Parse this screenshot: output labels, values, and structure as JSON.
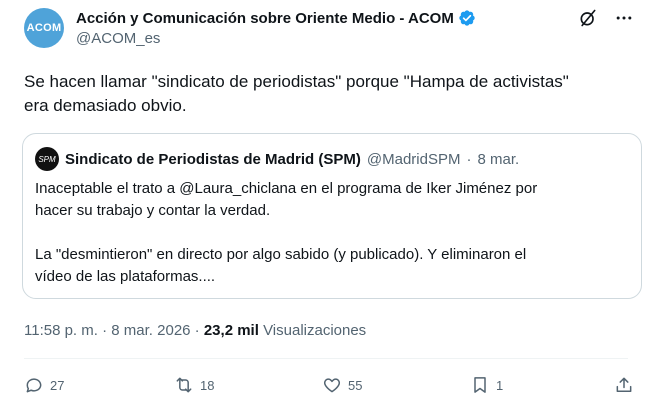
{
  "post": {
    "avatar_text": "ACOM",
    "author_name": "Acción y Comunicación sobre Oriente Medio - ACOM",
    "author_handle": "@ACOM_es",
    "text": "Se hacen llamar \"sindicato de periodistas\" porque \"Hampa de activistas\"\nera demasiado obvio."
  },
  "quoted": {
    "author_name": "Sindicato de Periodistas de Madrid (SPM)",
    "author_handle": "@MadridSPM",
    "separator": "·",
    "date": "8 mar.",
    "text": "Inaceptable el trato a @Laura_chiclana en el programa de Iker Jiménez por\nhacer su trabajo y contar la verdad.\n\nLa \"desmintieron\" en directo por algo sabido (y publicado). Y eliminaron el\nvídeo de las plataformas...."
  },
  "meta": {
    "time": "11:58 p. m.",
    "separator": "·",
    "date": "8 mar. 2026",
    "views_count": "23,2 mil",
    "views_label": "Visualizaciones"
  },
  "actions": {
    "replies": "27",
    "reposts": "18",
    "likes": "55",
    "bookmarks": "1"
  },
  "colors": {
    "verified": "#1d9bf0",
    "secondary_text": "#536471",
    "border": "#cfd9de"
  },
  "icons": [
    "verified-badge-icon",
    "grok-icon",
    "more-icon",
    "reply-icon",
    "repost-icon",
    "like-icon",
    "bookmark-icon",
    "share-icon"
  ]
}
